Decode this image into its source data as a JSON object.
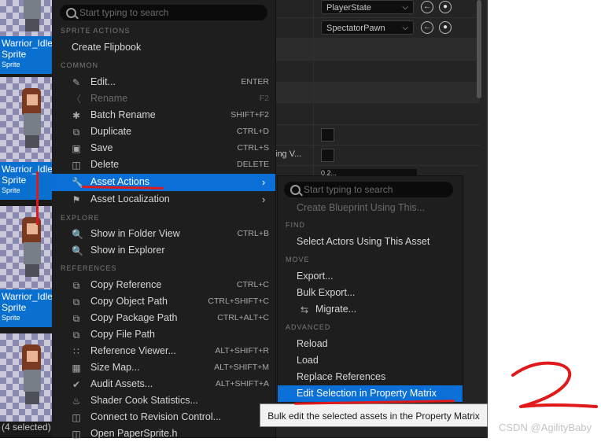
{
  "assets": [
    {
      "name": "Warrior_Idle",
      "type_title": "Sprite",
      "type_small": "Sprite"
    },
    {
      "name": "Warrior_Idle",
      "type_title": "Sprite",
      "type_small": "Sprite"
    },
    {
      "name": "Warrior_Idle",
      "type_title": "Sprite",
      "type_small": "Sprite"
    }
  ],
  "selection_status": "(4 selected)",
  "details": {
    "player_state": "PlayerState",
    "spectator_pawn": "SpectatorPawn",
    "truncated_label": "ing V...",
    "truncated_value": "0.2..."
  },
  "menu": {
    "search_placeholder": "Start typing to search",
    "sections": {
      "sprite_actions": "SPRITE ACTIONS",
      "common": "COMMON",
      "explore": "EXPLORE",
      "references": "REFERENCES"
    },
    "sprite_items": [
      {
        "label": "Create Flipbook"
      }
    ],
    "common_items": [
      {
        "label": "Edit...",
        "shortcut": "ENTER",
        "icon": "pencil-icon"
      },
      {
        "label": "Rename",
        "shortcut": "F2",
        "icon": "rename-icon"
      },
      {
        "label": "Batch Rename",
        "shortcut": "SHIFT+F2",
        "icon": "asterisk-icon"
      },
      {
        "label": "Duplicate",
        "shortcut": "CTRL+D",
        "icon": "duplicate-icon"
      },
      {
        "label": "Save",
        "shortcut": "CTRL+S",
        "icon": "save-icon"
      },
      {
        "label": "Delete",
        "shortcut": "DELETE",
        "icon": "trash-icon"
      },
      {
        "label": "Asset Actions",
        "shortcut": "",
        "icon": "wrench-icon"
      },
      {
        "label": "Asset Localization",
        "shortcut": "",
        "icon": "flag-icon"
      }
    ],
    "explore_items": [
      {
        "label": "Show in Folder View",
        "shortcut": "CTRL+B",
        "icon": "folder-search-icon"
      },
      {
        "label": "Show in Explorer",
        "shortcut": "",
        "icon": "folder-search-icon"
      }
    ],
    "reference_items": [
      {
        "label": "Copy Reference",
        "shortcut": "CTRL+C",
        "icon": "copy-icon"
      },
      {
        "label": "Copy Object Path",
        "shortcut": "CTRL+SHIFT+C",
        "icon": "copy-icon"
      },
      {
        "label": "Copy Package Path",
        "shortcut": "CTRL+ALT+C",
        "icon": "copy-icon"
      },
      {
        "label": "Copy File Path",
        "shortcut": "",
        "icon": "copy-icon"
      },
      {
        "label": "Reference Viewer...",
        "shortcut": "ALT+SHIFT+R",
        "icon": "graph-icon"
      },
      {
        "label": "Size Map...",
        "shortcut": "ALT+SHIFT+M",
        "icon": "grid-icon"
      },
      {
        "label": "Audit Assets...",
        "shortcut": "ALT+SHIFT+A",
        "icon": "audit-icon"
      },
      {
        "label": "Shader Cook Statistics...",
        "shortcut": "",
        "icon": "stats-icon"
      },
      {
        "label": "Connect to Revision Control...",
        "shortcut": "",
        "icon": "revision-icon"
      },
      {
        "label": "Open PaperSprite.h",
        "shortcut": "",
        "icon": "code-icon"
      }
    ]
  },
  "submenu": {
    "search_placeholder": "Start typing to search",
    "create_blueprint": "Create Blueprint Using This...",
    "sections": {
      "find": "FIND",
      "move": "MOVE",
      "advanced": "ADVANCED"
    },
    "find_items": [
      "Select Actors Using This Asset"
    ],
    "move_items": [
      "Export...",
      "Bulk Export...",
      "Migrate..."
    ],
    "advanced_items": [
      "Reload",
      "Load",
      "Replace References",
      "Edit Selection in Property Matrix"
    ]
  },
  "tooltip": "Bulk edit the selected assets in the Property Matrix",
  "watermark": "CSDN @AgilityBaby",
  "colors": {
    "highlight": "#0a70d8",
    "annotation": "#e01a1a"
  }
}
